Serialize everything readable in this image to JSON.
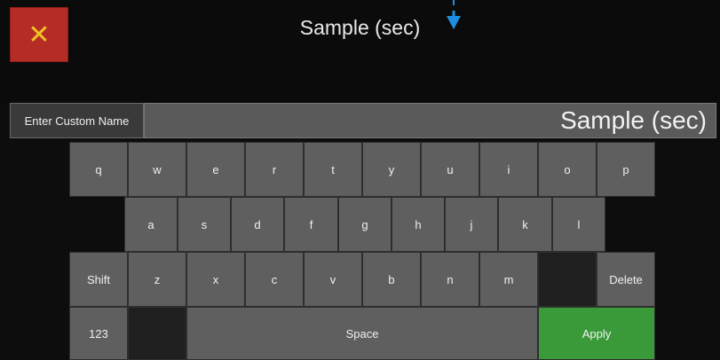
{
  "header": {
    "close_icon": "✕",
    "title": "Sample (sec)"
  },
  "name_row": {
    "label": "Enter Custom Name",
    "value": "Sample (sec)"
  },
  "keyboard": {
    "row1": [
      "q",
      "w",
      "e",
      "r",
      "t",
      "y",
      "u",
      "i",
      "o",
      "p"
    ],
    "row2": [
      "a",
      "s",
      "d",
      "f",
      "g",
      "h",
      "j",
      "k",
      "l"
    ],
    "row3": [
      "Shift",
      "z",
      "x",
      "c",
      "v",
      "b",
      "n",
      "m",
      "",
      "Delete"
    ],
    "row4": {
      "numbers": "123",
      "space": "Space",
      "apply": "Apply"
    }
  },
  "colors": {
    "close_bg": "#b52c26",
    "close_icon": "#f0c322",
    "apply_bg": "#3a9a3a",
    "arrow": "#1e8fe0"
  }
}
